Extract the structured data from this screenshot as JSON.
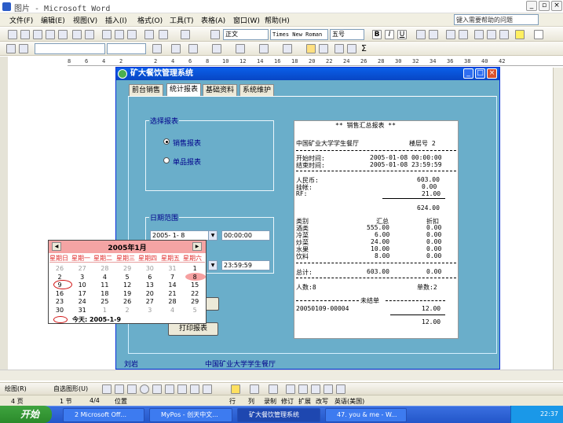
{
  "word": {
    "title": "图片 - Microsoft Word",
    "menu": [
      "文件(F)",
      "编辑(E)",
      "视图(V)",
      "插入(I)",
      "格式(O)",
      "工具(T)",
      "表格(A)",
      "窗口(W)",
      "帮助(H)"
    ],
    "help_placeholder": "键入需要帮助的问题",
    "style_combo": "正文",
    "font_combo": "Times New Roman",
    "size_combo": "五号",
    "ruler_numbers": [
      "8",
      "6",
      "4",
      "2",
      "2",
      "4",
      "6",
      "8",
      "10",
      "12",
      "14",
      "16",
      "18",
      "20",
      "22",
      "24",
      "26",
      "28",
      "30",
      "32",
      "34",
      "36",
      "38",
      "40",
      "42"
    ],
    "status": {
      "page": "4 页",
      "section": "1 节",
      "pages": "4/4",
      "position": "位置",
      "line": "行",
      "col": "列",
      "rec": "录制",
      "trk": "修订",
      "ext": "扩展",
      "ovr": "改写",
      "lang": "英语(美国)"
    },
    "drawing_label": "绘图(R)",
    "autoshapes_label": "自选图形(U)"
  },
  "app": {
    "title": "矿大餐饮管理系统",
    "tabs": [
      "前台销售",
      "统计报表",
      "基础资料",
      "系统维护"
    ],
    "selected_tab": 1,
    "select_group": {
      "title": "选择报表",
      "options": [
        "销售报表",
        "单品报表"
      ],
      "selected": 0
    },
    "date_group": {
      "title": "日期范围",
      "start_date": "2005- 1- 8",
      "start_time": "00:00:00",
      "end_time": "23:59:59"
    },
    "print_button": "打印报表",
    "footer_user": "刘岩",
    "footer_org": "中国矿业大学学生餐厅",
    "report": {
      "title": "** 销售汇总报表 **",
      "org": "中国矿业大学学生餐厅",
      "floor": "楼层号 2",
      "start_label": "开始时间:",
      "start_value": "2005-01-08 00:00:00",
      "end_label": "结束时间:",
      "end_value": "2005-01-08 23:59:59",
      "payments": [
        {
          "label": "人民币:",
          "value": "603.00"
        },
        {
          "label": "挂帐:",
          "value": "0.00"
        },
        {
          "label": "RF:",
          "value": "21.00"
        }
      ],
      "payment_total": "624.00",
      "col_category": "类别",
      "col_total": "汇总",
      "col_discount": "折扣",
      "categories": [
        {
          "name": "酒类",
          "total": "555.00",
          "discount": "0.00"
        },
        {
          "name": "冷菜",
          "total": "6.00",
          "discount": "0.00"
        },
        {
          "name": "炒菜",
          "total": "24.00",
          "discount": "0.00"
        },
        {
          "name": "水果",
          "total": "10.00",
          "discount": "0.00"
        },
        {
          "name": "饮料",
          "total": "8.00",
          "discount": "0.00"
        }
      ],
      "grand_label": "总计:",
      "grand_total": "603.00",
      "grand_discount": "0.00",
      "people": "人数:8",
      "bills": "单数:2",
      "unsettled": "未结单",
      "bill_no": "20050109-00004",
      "bill_amount": "12.00",
      "bill_total": "12.00"
    },
    "calendar": {
      "title": "2005年1月",
      "weekdays": [
        "星期日",
        "星期一",
        "星期二",
        "星期三",
        "星期四",
        "星期五",
        "星期六"
      ],
      "weeks": [
        [
          "26",
          "27",
          "28",
          "29",
          "30",
          "31",
          "1"
        ],
        [
          "2",
          "3",
          "4",
          "5",
          "6",
          "7",
          "8"
        ],
        [
          "9",
          "10",
          "11",
          "12",
          "13",
          "14",
          "15"
        ],
        [
          "16",
          "17",
          "18",
          "19",
          "20",
          "21",
          "22"
        ],
        [
          "23",
          "24",
          "25",
          "26",
          "27",
          "28",
          "29"
        ],
        [
          "30",
          "31",
          "1",
          "2",
          "3",
          "4",
          "5"
        ]
      ],
      "today": "今天: 2005-1-9"
    }
  },
  "taskbar": {
    "start": "开始",
    "tasks": [
      "2 Microsoft Off...",
      "MyPos - 创天中文...",
      "矿大餐饮管理系统",
      "47. you & me - W..."
    ],
    "time": "22:37"
  }
}
